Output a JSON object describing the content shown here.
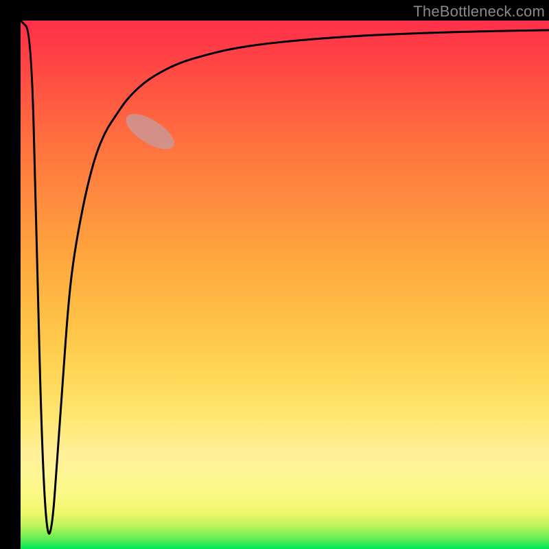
{
  "attribution": "TheBottleneck.com",
  "colors": {
    "frame": "#000000",
    "gradient_top": "#ff2f49",
    "gradient_bottom": "#00e756",
    "curve": "#000000",
    "marker": "#c79a9c"
  },
  "chart_data": {
    "type": "line",
    "title": "",
    "xlabel": "",
    "ylabel": "",
    "xlim": [
      0,
      100
    ],
    "ylim": [
      0,
      100
    ],
    "grid": false,
    "series": [
      {
        "name": "bottleneck-curve",
        "x": [
          0,
          2,
          3,
          4,
          5,
          6,
          7,
          8,
          9,
          10,
          12,
          14,
          16,
          18,
          20,
          23,
          26,
          30,
          35,
          40,
          46,
          53,
          62,
          72,
          84,
          100
        ],
        "values": [
          100,
          98,
          60,
          20,
          2,
          4,
          18,
          32,
          46,
          55,
          66,
          74,
          79,
          82,
          85,
          88,
          90,
          92,
          93.5,
          94.7,
          95.6,
          96.3,
          97,
          97.5,
          97.9,
          98.2
        ]
      }
    ],
    "annotations": [
      {
        "name": "highlight-segment",
        "type": "ellipse",
        "center_x": 24.5,
        "center_y": 79,
        "rx": 2.2,
        "ry": 5.2,
        "angle_deg": 58
      }
    ]
  }
}
